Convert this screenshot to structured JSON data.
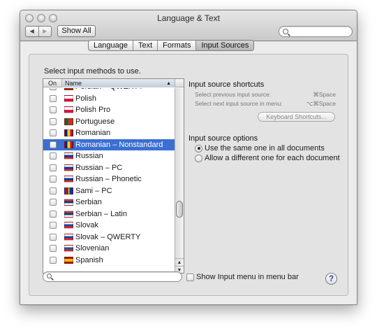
{
  "window": {
    "title": "Language & Text",
    "nav_back": "◀",
    "nav_forward": "▶",
    "show_all": "Show All",
    "search_placeholder": ""
  },
  "tabs": [
    {
      "label": "Language",
      "active": false
    },
    {
      "label": "Text",
      "active": false
    },
    {
      "label": "Formats",
      "active": false
    },
    {
      "label": "Input Sources",
      "active": true
    }
  ],
  "input_methods": {
    "instruction": "Select input methods to use.",
    "col_on": "On",
    "col_name": "Name",
    "sort_arrow": "▲",
    "rows": [
      {
        "name": "Persian – QWERTY",
        "flag": "persian",
        "checked": false,
        "selected": false
      },
      {
        "name": "Polish",
        "flag": "poland",
        "checked": false,
        "selected": false
      },
      {
        "name": "Polish Pro",
        "flag": "poland",
        "checked": false,
        "selected": false
      },
      {
        "name": "Portuguese",
        "flag": "portugal",
        "checked": false,
        "selected": false
      },
      {
        "name": "Romanian",
        "flag": "romania",
        "checked": false,
        "selected": false
      },
      {
        "name": "Romanian – Nonstandard",
        "flag": "romania",
        "checked": false,
        "selected": true
      },
      {
        "name": "Russian",
        "flag": "russia",
        "checked": false,
        "selected": false
      },
      {
        "name": "Russian – PC",
        "flag": "russia",
        "checked": false,
        "selected": false
      },
      {
        "name": "Russian – Phonetic",
        "flag": "russia",
        "checked": false,
        "selected": false
      },
      {
        "name": "Sami – PC",
        "flag": "sami",
        "checked": false,
        "selected": false
      },
      {
        "name": "Serbian",
        "flag": "serbia",
        "checked": false,
        "selected": false
      },
      {
        "name": "Serbian – Latin",
        "flag": "serbia",
        "checked": false,
        "selected": false
      },
      {
        "name": "Slovak",
        "flag": "slovakia",
        "checked": false,
        "selected": false
      },
      {
        "name": "Slovak – QWERTY",
        "flag": "slovakia",
        "checked": false,
        "selected": false
      },
      {
        "name": "Slovenian",
        "flag": "slovenia",
        "checked": false,
        "selected": false
      },
      {
        "name": "Spanish",
        "flag": "spain",
        "checked": false,
        "selected": false
      }
    ],
    "filter_placeholder": ""
  },
  "shortcuts": {
    "title": "Input source shortcuts",
    "prev_label": "Select previous input source:",
    "prev_value": "⌘Space",
    "next_label": "Select next input source in menu:",
    "next_value": "⌥⌘Space",
    "keyboard_button": "Keyboard Shortcuts..."
  },
  "options": {
    "title": "Input source options",
    "same_label": "Use the same one in all documents",
    "different_label": "Allow a different one for each document",
    "selected": "same"
  },
  "bottom": {
    "show_menu_label": "Show Input menu in menu bar",
    "help_label": "?"
  }
}
